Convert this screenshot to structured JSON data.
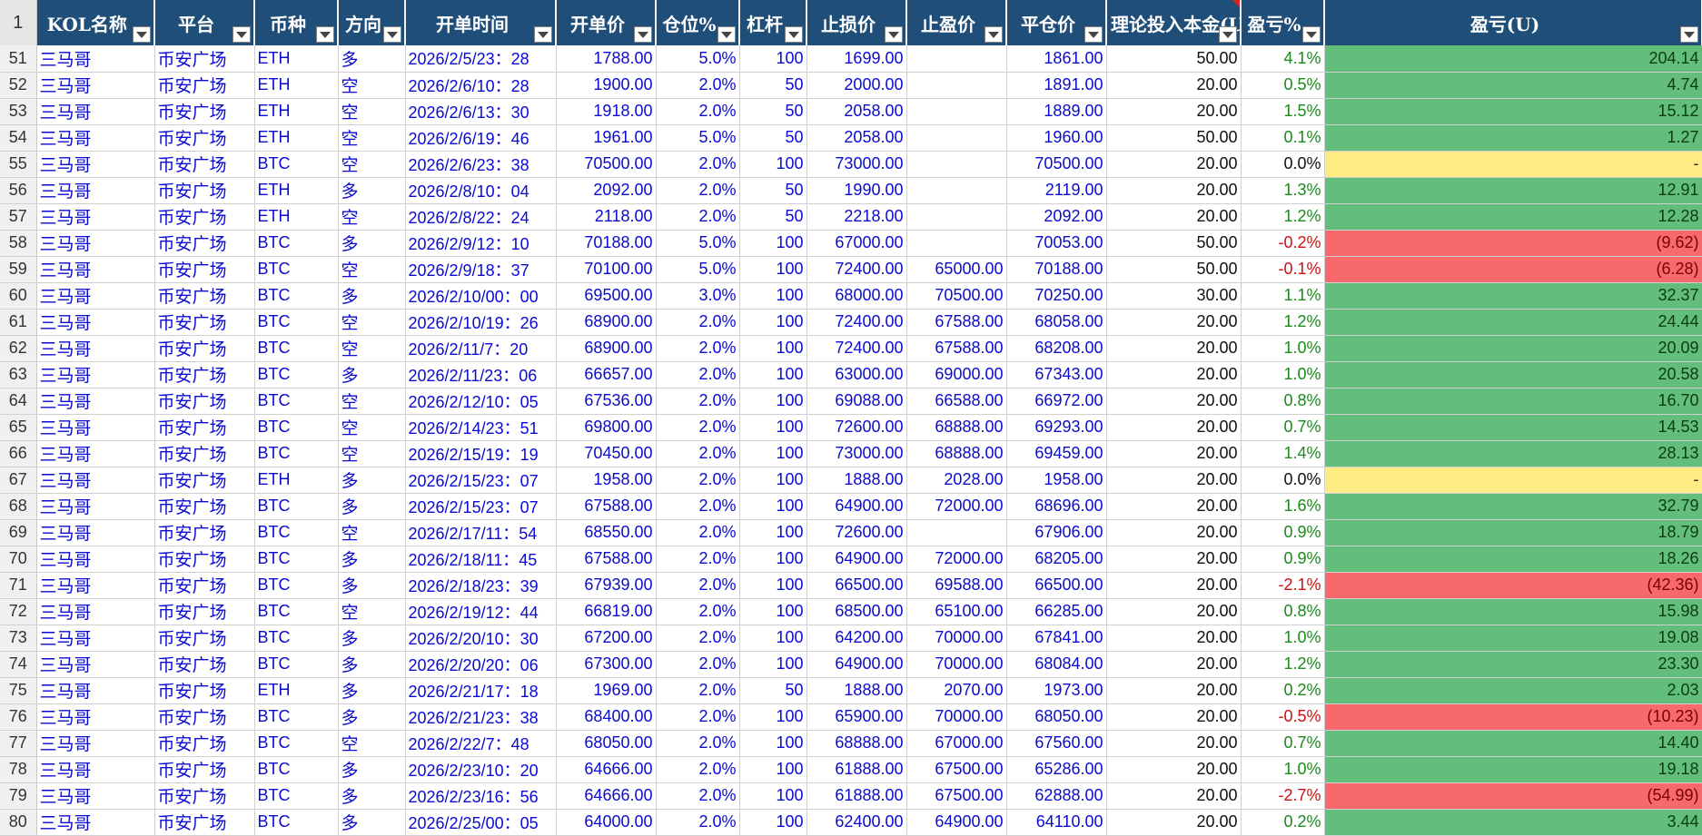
{
  "header": {
    "row_label": "1",
    "columns": [
      "KOL名称",
      "平台",
      "币种",
      "方向",
      "开单时间",
      "开单价",
      "仓位%",
      "杠杆",
      "止损价",
      "止盈价",
      "平仓价",
      "理论投入本金(U)",
      "盈亏%",
      "盈亏(U)"
    ]
  },
  "colors": {
    "header_bg": "#1f4e79",
    "text_blue": "#0a0ad2",
    "profit_green": "#63be7b",
    "loss_red": "#f8696b",
    "neutral_yellow": "#ffeb84"
  },
  "rows": [
    {
      "n": "51",
      "kol": "三马哥",
      "platform": "币安广场",
      "coin": "ETH",
      "dir": "多",
      "time": "2026/2/5/23：28",
      "open": "1788.00",
      "pos": "5.0%",
      "lev": "100",
      "sl": "1699.00",
      "tp": "",
      "close": "1861.00",
      "capital": "50.00",
      "pct": "4.1%",
      "pnl": "204.14"
    },
    {
      "n": "52",
      "kol": "三马哥",
      "platform": "币安广场",
      "coin": "ETH",
      "dir": "空",
      "time": "2026/2/6/10：28",
      "open": "1900.00",
      "pos": "2.0%",
      "lev": "50",
      "sl": "2000.00",
      "tp": "",
      "close": "1891.00",
      "capital": "20.00",
      "pct": "0.5%",
      "pnl": "4.74"
    },
    {
      "n": "53",
      "kol": "三马哥",
      "platform": "币安广场",
      "coin": "ETH",
      "dir": "空",
      "time": "2026/2/6/13：30",
      "open": "1918.00",
      "pos": "2.0%",
      "lev": "50",
      "sl": "2058.00",
      "tp": "",
      "close": "1889.00",
      "capital": "20.00",
      "pct": "1.5%",
      "pnl": "15.12"
    },
    {
      "n": "54",
      "kol": "三马哥",
      "platform": "币安广场",
      "coin": "ETH",
      "dir": "空",
      "time": "2026/2/6/19：46",
      "open": "1961.00",
      "pos": "5.0%",
      "lev": "50",
      "sl": "2058.00",
      "tp": "",
      "close": "1960.00",
      "capital": "50.00",
      "pct": "0.1%",
      "pnl": "1.27"
    },
    {
      "n": "55",
      "kol": "三马哥",
      "platform": "币安广场",
      "coin": "BTC",
      "dir": "空",
      "time": "2026/2/6/23：38",
      "open": "70500.00",
      "pos": "2.0%",
      "lev": "100",
      "sl": "73000.00",
      "tp": "",
      "close": "70500.00",
      "capital": "20.00",
      "pct": "0.0%",
      "pnl": "-"
    },
    {
      "n": "56",
      "kol": "三马哥",
      "platform": "币安广场",
      "coin": "ETH",
      "dir": "多",
      "time": "2026/2/8/10：04",
      "open": "2092.00",
      "pos": "2.0%",
      "lev": "50",
      "sl": "1990.00",
      "tp": "",
      "close": "2119.00",
      "capital": "20.00",
      "pct": "1.3%",
      "pnl": "12.91"
    },
    {
      "n": "57",
      "kol": "三马哥",
      "platform": "币安广场",
      "coin": "ETH",
      "dir": "空",
      "time": "2026/2/8/22：24",
      "open": "2118.00",
      "pos": "2.0%",
      "lev": "50",
      "sl": "2218.00",
      "tp": "",
      "close": "2092.00",
      "capital": "20.00",
      "pct": "1.2%",
      "pnl": "12.28"
    },
    {
      "n": "58",
      "kol": "三马哥",
      "platform": "币安广场",
      "coin": "BTC",
      "dir": "多",
      "time": "2026/2/9/12：10",
      "open": "70188.00",
      "pos": "5.0%",
      "lev": "100",
      "sl": "67000.00",
      "tp": "",
      "close": "70053.00",
      "capital": "50.00",
      "pct": "-0.2%",
      "pnl": "(9.62)"
    },
    {
      "n": "59",
      "kol": "三马哥",
      "platform": "币安广场",
      "coin": "BTC",
      "dir": "空",
      "time": "2026/2/9/18：37",
      "open": "70100.00",
      "pos": "5.0%",
      "lev": "100",
      "sl": "72400.00",
      "tp": "65000.00",
      "close": "70188.00",
      "capital": "50.00",
      "pct": "-0.1%",
      "pnl": "(6.28)"
    },
    {
      "n": "60",
      "kol": "三马哥",
      "platform": "币安广场",
      "coin": "BTC",
      "dir": "多",
      "time": "2026/2/10/00：00",
      "open": "69500.00",
      "pos": "3.0%",
      "lev": "100",
      "sl": "68000.00",
      "tp": "70500.00",
      "close": "70250.00",
      "capital": "30.00",
      "pct": "1.1%",
      "pnl": "32.37"
    },
    {
      "n": "61",
      "kol": "三马哥",
      "platform": "币安广场",
      "coin": "BTC",
      "dir": "空",
      "time": "2026/2/10/19：26",
      "open": "68900.00",
      "pos": "2.0%",
      "lev": "100",
      "sl": "72400.00",
      "tp": "67588.00",
      "close": "68058.00",
      "capital": "20.00",
      "pct": "1.2%",
      "pnl": "24.44"
    },
    {
      "n": "62",
      "kol": "三马哥",
      "platform": "币安广场",
      "coin": "BTC",
      "dir": "空",
      "time": "2026/2/11/7：20",
      "open": "68900.00",
      "pos": "2.0%",
      "lev": "100",
      "sl": "72400.00",
      "tp": "67588.00",
      "close": "68208.00",
      "capital": "20.00",
      "pct": "1.0%",
      "pnl": "20.09"
    },
    {
      "n": "63",
      "kol": "三马哥",
      "platform": "币安广场",
      "coin": "BTC",
      "dir": "多",
      "time": "2026/2/11/23：06",
      "open": "66657.00",
      "pos": "2.0%",
      "lev": "100",
      "sl": "63000.00",
      "tp": "69000.00",
      "close": "67343.00",
      "capital": "20.00",
      "pct": "1.0%",
      "pnl": "20.58"
    },
    {
      "n": "64",
      "kol": "三马哥",
      "platform": "币安广场",
      "coin": "BTC",
      "dir": "空",
      "time": "2026/2/12/10：05",
      "open": "67536.00",
      "pos": "2.0%",
      "lev": "100",
      "sl": "69088.00",
      "tp": "66588.00",
      "close": "66972.00",
      "capital": "20.00",
      "pct": "0.8%",
      "pnl": "16.70"
    },
    {
      "n": "65",
      "kol": "三马哥",
      "platform": "币安广场",
      "coin": "BTC",
      "dir": "空",
      "time": "2026/2/14/23：51",
      "open": "69800.00",
      "pos": "2.0%",
      "lev": "100",
      "sl": "72600.00",
      "tp": "68888.00",
      "close": "69293.00",
      "capital": "20.00",
      "pct": "0.7%",
      "pnl": "14.53"
    },
    {
      "n": "66",
      "kol": "三马哥",
      "platform": "币安广场",
      "coin": "BTC",
      "dir": "空",
      "time": "2026/2/15/19：19",
      "open": "70450.00",
      "pos": "2.0%",
      "lev": "100",
      "sl": "73000.00",
      "tp": "68888.00",
      "close": "69459.00",
      "capital": "20.00",
      "pct": "1.4%",
      "pnl": "28.13"
    },
    {
      "n": "67",
      "kol": "三马哥",
      "platform": "币安广场",
      "coin": "ETH",
      "dir": "多",
      "time": "2026/2/15/23：07",
      "open": "1958.00",
      "pos": "2.0%",
      "lev": "100",
      "sl": "1888.00",
      "tp": "2028.00",
      "close": "1958.00",
      "capital": "20.00",
      "pct": "0.0%",
      "pnl": "-"
    },
    {
      "n": "68",
      "kol": "三马哥",
      "platform": "币安广场",
      "coin": "BTC",
      "dir": "多",
      "time": "2026/2/15/23：07",
      "open": "67588.00",
      "pos": "2.0%",
      "lev": "100",
      "sl": "64900.00",
      "tp": "72000.00",
      "close": "68696.00",
      "capital": "20.00",
      "pct": "1.6%",
      "pnl": "32.79"
    },
    {
      "n": "69",
      "kol": "三马哥",
      "platform": "币安广场",
      "coin": "BTC",
      "dir": "空",
      "time": "2026/2/17/11：54",
      "open": "68550.00",
      "pos": "2.0%",
      "lev": "100",
      "sl": "72600.00",
      "tp": "",
      "close": "67906.00",
      "capital": "20.00",
      "pct": "0.9%",
      "pnl": "18.79"
    },
    {
      "n": "70",
      "kol": "三马哥",
      "platform": "币安广场",
      "coin": "BTC",
      "dir": "多",
      "time": "2026/2/18/11：45",
      "open": "67588.00",
      "pos": "2.0%",
      "lev": "100",
      "sl": "64900.00",
      "tp": "72000.00",
      "close": "68205.00",
      "capital": "20.00",
      "pct": "0.9%",
      "pnl": "18.26"
    },
    {
      "n": "71",
      "kol": "三马哥",
      "platform": "币安广场",
      "coin": "BTC",
      "dir": "多",
      "time": "2026/2/18/23：39",
      "open": "67939.00",
      "pos": "2.0%",
      "lev": "100",
      "sl": "66500.00",
      "tp": "69588.00",
      "close": "66500.00",
      "capital": "20.00",
      "pct": "-2.1%",
      "pnl": "(42.36)"
    },
    {
      "n": "72",
      "kol": "三马哥",
      "platform": "币安广场",
      "coin": "BTC",
      "dir": "空",
      "time": "2026/2/19/12：44",
      "open": "66819.00",
      "pos": "2.0%",
      "lev": "100",
      "sl": "68500.00",
      "tp": "65100.00",
      "close": "66285.00",
      "capital": "20.00",
      "pct": "0.8%",
      "pnl": "15.98"
    },
    {
      "n": "73",
      "kol": "三马哥",
      "platform": "币安广场",
      "coin": "BTC",
      "dir": "多",
      "time": "2026/2/20/10：30",
      "open": "67200.00",
      "pos": "2.0%",
      "lev": "100",
      "sl": "64200.00",
      "tp": "70000.00",
      "close": "67841.00",
      "capital": "20.00",
      "pct": "1.0%",
      "pnl": "19.08"
    },
    {
      "n": "74",
      "kol": "三马哥",
      "platform": "币安广场",
      "coin": "BTC",
      "dir": "多",
      "time": "2026/2/20/20：06",
      "open": "67300.00",
      "pos": "2.0%",
      "lev": "100",
      "sl": "64900.00",
      "tp": "70000.00",
      "close": "68084.00",
      "capital": "20.00",
      "pct": "1.2%",
      "pnl": "23.30"
    },
    {
      "n": "75",
      "kol": "三马哥",
      "platform": "币安广场",
      "coin": "ETH",
      "dir": "多",
      "time": "2026/2/21/17：18",
      "open": "1969.00",
      "pos": "2.0%",
      "lev": "50",
      "sl": "1888.00",
      "tp": "2070.00",
      "close": "1973.00",
      "capital": "20.00",
      "pct": "0.2%",
      "pnl": "2.03"
    },
    {
      "n": "76",
      "kol": "三马哥",
      "platform": "币安广场",
      "coin": "BTC",
      "dir": "多",
      "time": "2026/2/21/23：38",
      "open": "68400.00",
      "pos": "2.0%",
      "lev": "100",
      "sl": "65900.00",
      "tp": "70000.00",
      "close": "68050.00",
      "capital": "20.00",
      "pct": "-0.5%",
      "pnl": "(10.23)"
    },
    {
      "n": "77",
      "kol": "三马哥",
      "platform": "币安广场",
      "coin": "BTC",
      "dir": "空",
      "time": "2026/2/22/7：48",
      "open": "68050.00",
      "pos": "2.0%",
      "lev": "100",
      "sl": "68888.00",
      "tp": "67000.00",
      "close": "67560.00",
      "capital": "20.00",
      "pct": "0.7%",
      "pnl": "14.40"
    },
    {
      "n": "78",
      "kol": "三马哥",
      "platform": "币安广场",
      "coin": "BTC",
      "dir": "多",
      "time": "2026/2/23/10：20",
      "open": "64666.00",
      "pos": "2.0%",
      "lev": "100",
      "sl": "61888.00",
      "tp": "67500.00",
      "close": "65286.00",
      "capital": "20.00",
      "pct": "1.0%",
      "pnl": "19.18"
    },
    {
      "n": "79",
      "kol": "三马哥",
      "platform": "币安广场",
      "coin": "BTC",
      "dir": "多",
      "time": "2026/2/23/16：56",
      "open": "64666.00",
      "pos": "2.0%",
      "lev": "100",
      "sl": "61888.00",
      "tp": "67500.00",
      "close": "62888.00",
      "capital": "20.00",
      "pct": "-2.7%",
      "pnl": "(54.99)"
    },
    {
      "n": "80",
      "kol": "三马哥",
      "platform": "币安广场",
      "coin": "BTC",
      "dir": "多",
      "time": "2026/2/25/00：05",
      "open": "64000.00",
      "pos": "2.0%",
      "lev": "100",
      "sl": "62400.00",
      "tp": "64900.00",
      "close": "64110.00",
      "capital": "20.00",
      "pct": "0.2%",
      "pnl": "3.44"
    }
  ]
}
